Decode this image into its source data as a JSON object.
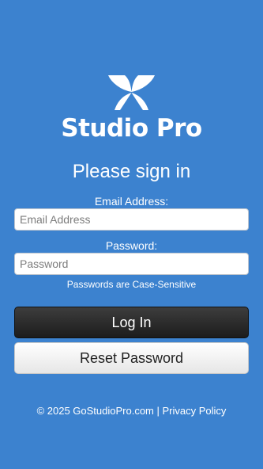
{
  "brand": {
    "logo_icon": "butterfly-x-logo-icon",
    "name": "Studio Pro"
  },
  "login": {
    "heading": "Please sign in",
    "email_label": "Email Address:",
    "email_placeholder": "Email Address",
    "email_value": "",
    "password_label": "Password:",
    "password_placeholder": "Password",
    "password_value": "",
    "hint": "Passwords are Case-Sensitive",
    "login_button": "Log In",
    "reset_button": "Reset Password"
  },
  "footer": {
    "copyright": "© 2025 GoStudioPro.com",
    "separator": " | ",
    "privacy_link": "Privacy Policy"
  },
  "colors": {
    "background": "#3c82cf",
    "login_button": "#2a2a2a",
    "reset_button": "#f2f2f2"
  }
}
